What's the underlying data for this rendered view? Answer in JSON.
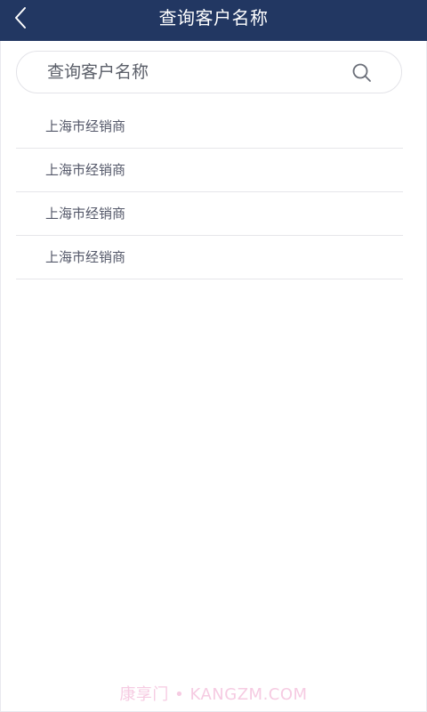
{
  "header": {
    "title": "查询客户名称",
    "back_icon": "chevron-left-icon",
    "background_color": "#223762"
  },
  "search": {
    "placeholder": "查询客户名称",
    "value": "",
    "icon": "search-icon"
  },
  "results": [
    {
      "label": "上海市经销商"
    },
    {
      "label": "上海市经销商"
    },
    {
      "label": "上海市经销商"
    },
    {
      "label": "上海市经销商"
    }
  ],
  "watermark": "康享门 • KANGZM.COM"
}
